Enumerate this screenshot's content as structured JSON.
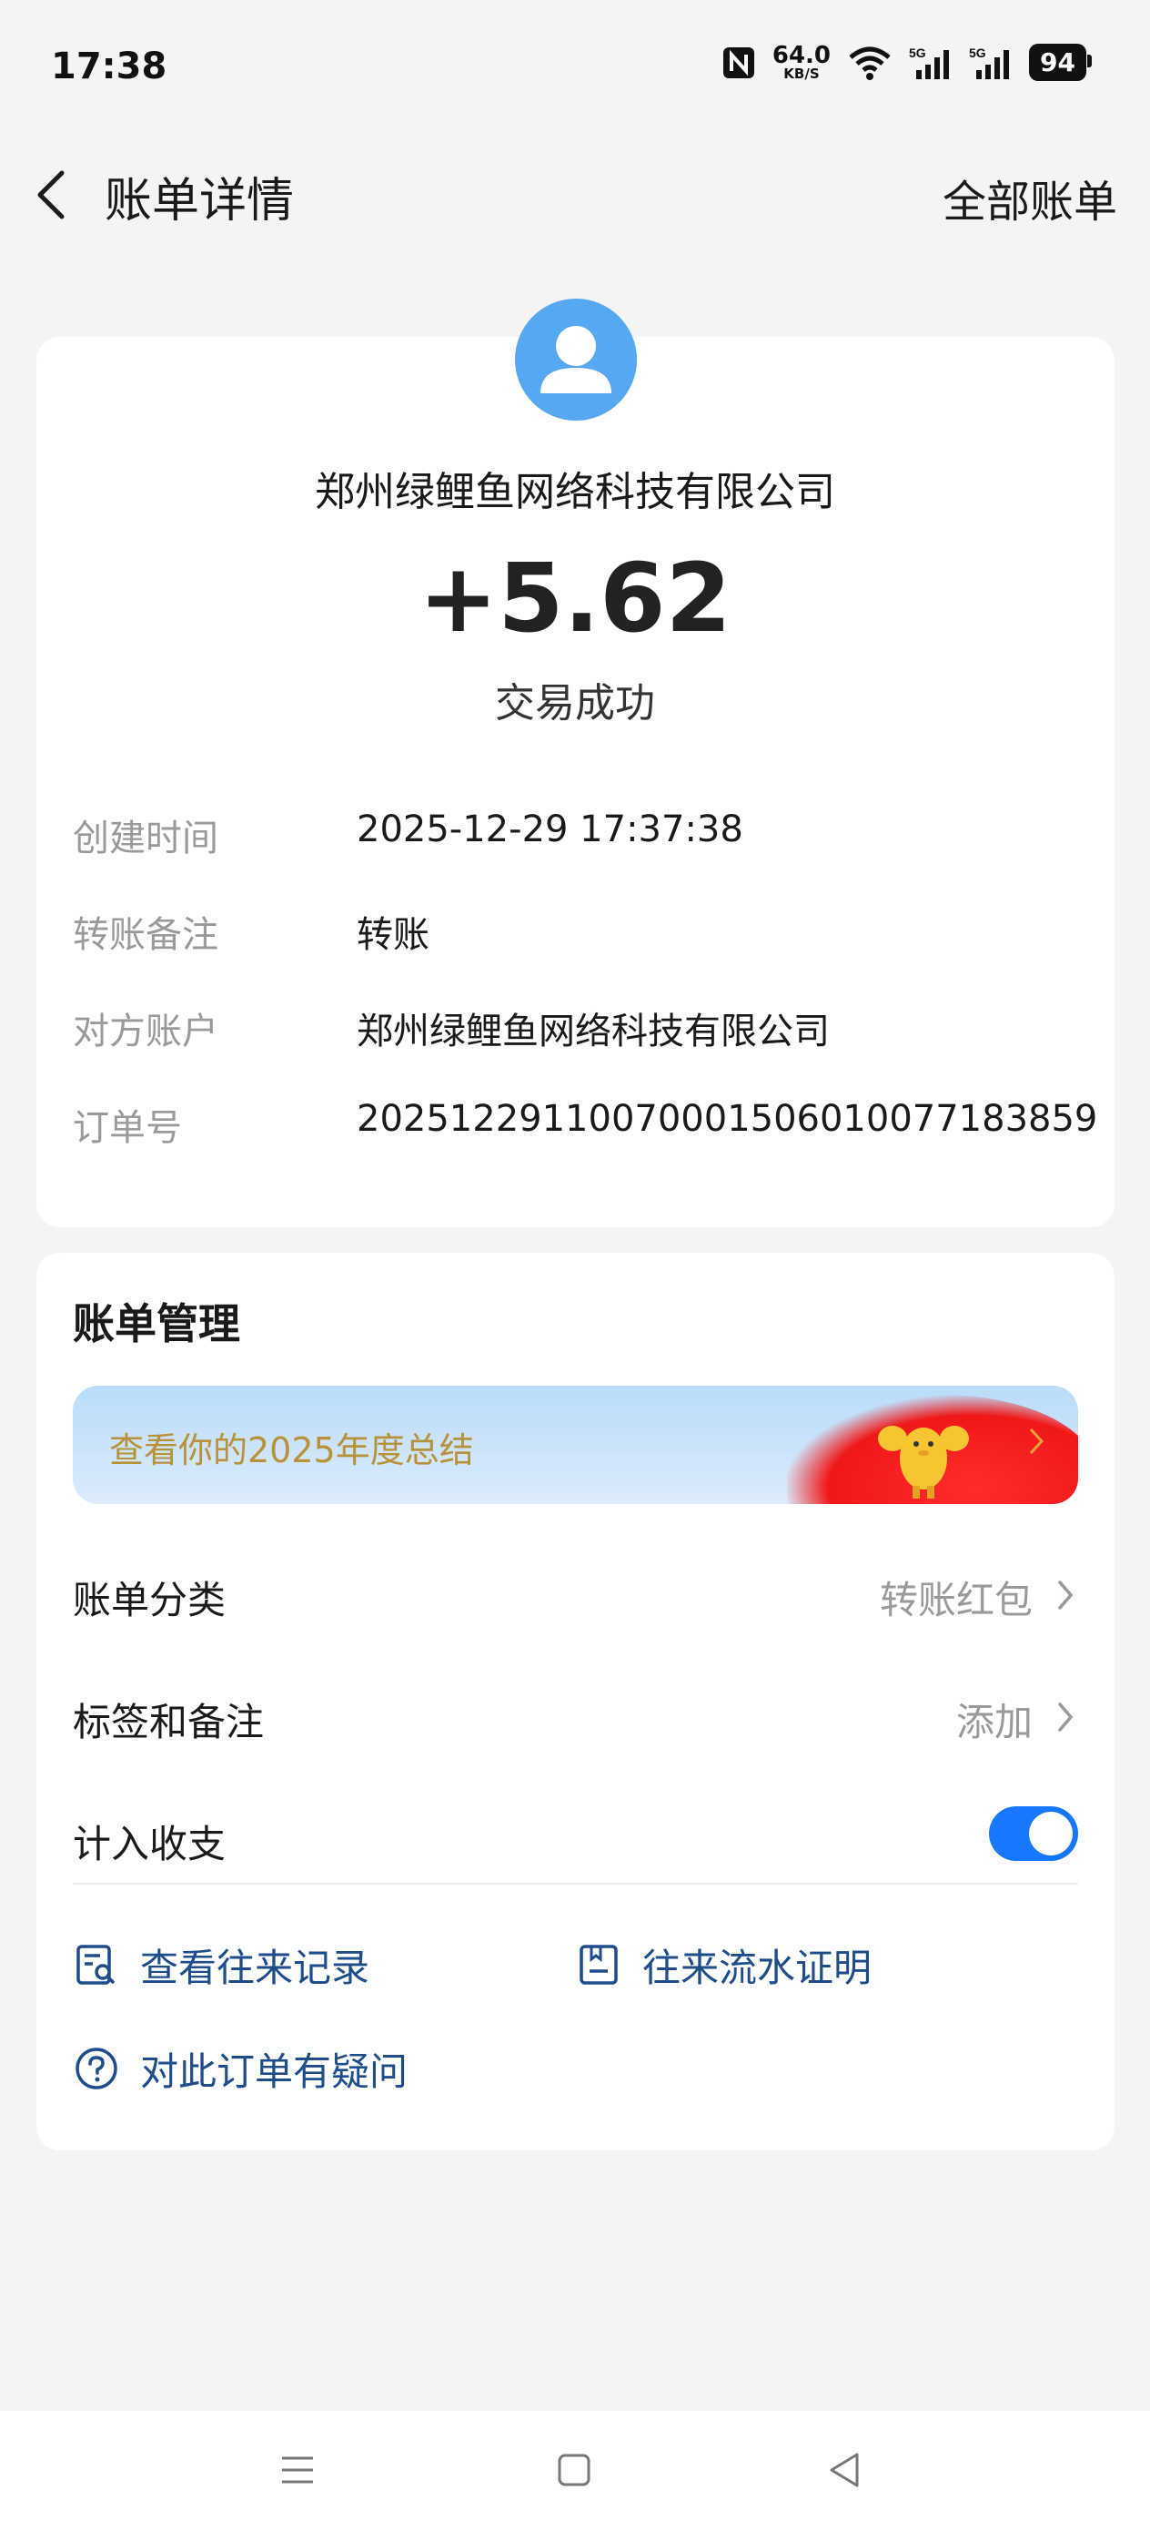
{
  "status_bar": {
    "time": "17:38",
    "net_speed_value": "64.0",
    "net_speed_unit": "KB/S",
    "signal_1_label": "5G",
    "signal_2_label": "5G",
    "battery": "94"
  },
  "header": {
    "title": "账单详情",
    "right_link": "全部账单"
  },
  "transaction": {
    "counterparty": "郑州绿鲤鱼网络科技有限公司",
    "amount": "+5.62",
    "status": "交易成功",
    "details": [
      {
        "label": "创建时间",
        "value": "2025-12-29 17:37:38"
      },
      {
        "label": "转账备注",
        "value": "转账"
      },
      {
        "label": "对方账户",
        "value": "郑州绿鲤鱼网络科技有限公司"
      },
      {
        "label": "订单号",
        "value": "20251229110070001506010077183859"
      }
    ]
  },
  "management": {
    "title": "账单管理",
    "banner_text": "查看你的2025年度总结",
    "rows": [
      {
        "label": "账单分类",
        "value": "转账红包"
      },
      {
        "label": "标签和备注",
        "value": "添加"
      },
      {
        "label": "计入收支",
        "value": ""
      }
    ],
    "include_in_stats": true,
    "links": [
      {
        "label": "查看往来记录",
        "icon": "record-search-icon"
      },
      {
        "label": "往来流水证明",
        "icon": "statement-icon"
      },
      {
        "label": "对此订单有疑问",
        "icon": "question-icon"
      }
    ]
  },
  "colors": {
    "accent_blue": "#1677ff",
    "avatar_blue": "#56a8f3",
    "link_blue": "#1f4d8c",
    "banner_gold": "#b8923a"
  }
}
